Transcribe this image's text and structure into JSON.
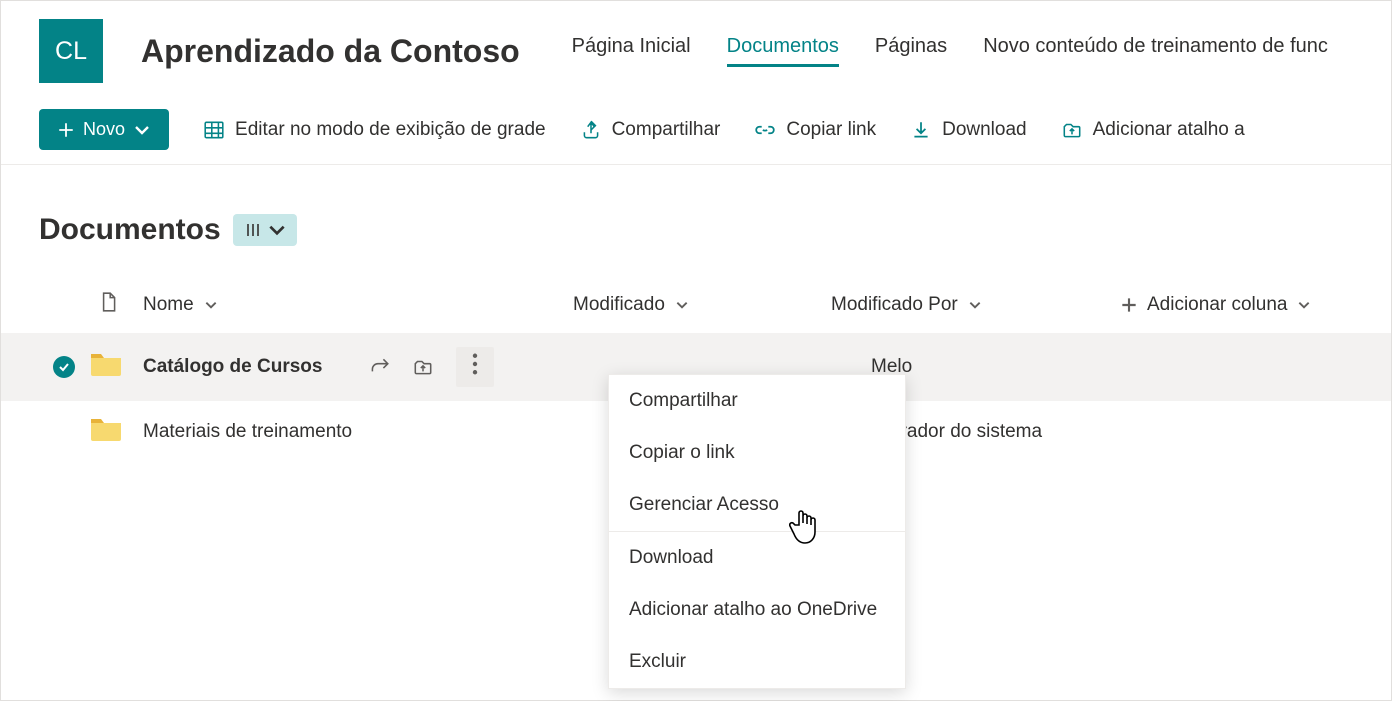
{
  "site": {
    "logo_initials": "CL",
    "title": "Aprendizado da Contoso"
  },
  "nav": {
    "items": [
      {
        "label": "Página Inicial",
        "active": false
      },
      {
        "label": "Documentos",
        "active": true
      },
      {
        "label": "Páginas",
        "active": false
      },
      {
        "label": "Novo conteúdo de treinamento de func",
        "active": false
      }
    ]
  },
  "commands": {
    "new": "Novo",
    "grid_edit": "Editar no modo de exibição de grade",
    "share": "Compartilhar",
    "copy_link": "Copiar link",
    "download": "Download",
    "add_shortcut": "Adicionar atalho a"
  },
  "library": {
    "title": "Documentos"
  },
  "columns": {
    "name": "Nome",
    "modified": "Modificado",
    "modified_by": "Modificado Por",
    "add_column": "Adicionar coluna"
  },
  "rows": [
    {
      "name": "Catálogo de Cursos",
      "modified": "",
      "modified_by": "Melo",
      "selected": true
    },
    {
      "name": "Materiais de treinamento",
      "modified": "",
      "modified_by": "nistrador do sistema",
      "selected": false
    }
  ],
  "context_menu": {
    "items": [
      {
        "label": "Compartilhar"
      },
      {
        "label": "Copiar o link"
      },
      {
        "label": "Gerenciar Acesso"
      },
      {
        "label": "Download",
        "sep": true
      },
      {
        "label": "Adicionar atalho ao OneDrive"
      },
      {
        "label": "Excluir"
      }
    ]
  }
}
